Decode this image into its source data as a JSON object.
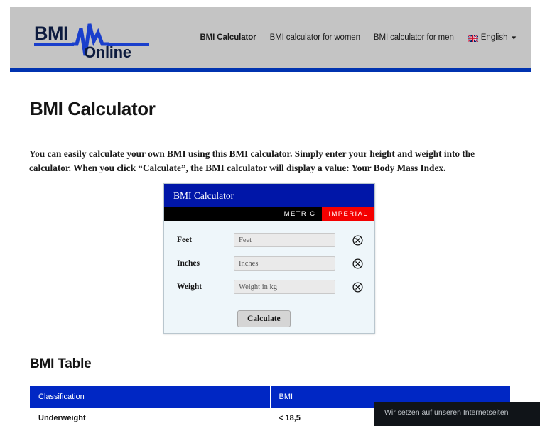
{
  "header": {
    "logo": {
      "primary_text": "BMI",
      "secondary_text": "Online",
      "icon": "heartbeat-pulse-icon",
      "color_dark": "#0d1b3e",
      "color_accent": "#1a3fcc"
    },
    "nav": [
      {
        "label": "BMI Calculator",
        "active": true
      },
      {
        "label": "BMI calculator for women",
        "active": false
      },
      {
        "label": "BMI calculator for men",
        "active": false
      }
    ],
    "language": {
      "label": "English",
      "flag": "uk-flag-icon",
      "chevron": "chevron-down-icon"
    },
    "bg_color": "#c4c4c4",
    "accent_stripe_color": "#0033b0"
  },
  "main": {
    "title": "BMI Calculator",
    "intro": "You can easily calculate your own BMI using this BMI calculator. Simply enter your height and weight into the calculator. When you click “Calculate”, the BMI calculator will display a value: Your Body Mass Index."
  },
  "calculator": {
    "title": "BMI Calculator",
    "title_bg": "#0016a8",
    "tabs": [
      {
        "label": "METRIC",
        "selected": false,
        "bg": "#000000"
      },
      {
        "label": "IMPERIAL",
        "selected": true,
        "bg": "#f40000"
      }
    ],
    "fields": [
      {
        "label": "Feet",
        "placeholder": "Feet",
        "value": "",
        "clear_icon": "circle-x-icon"
      },
      {
        "label": "Inches",
        "placeholder": "Inches",
        "value": "",
        "clear_icon": "circle-x-icon"
      },
      {
        "label": "Weight",
        "placeholder": "Weight in kg",
        "value": "",
        "clear_icon": "circle-x-icon"
      }
    ],
    "submit_label": "Calculate"
  },
  "bmi_table": {
    "title": "BMI Table",
    "header_bg": "#0027c4",
    "columns": [
      "Classification",
      "BMI"
    ],
    "rows": [
      {
        "classification": "Underweight",
        "bmi": "< 18,5"
      }
    ]
  },
  "cookie_banner": {
    "text": "Wir setzen auf unseren Internetseiten",
    "bg": "#101418"
  }
}
